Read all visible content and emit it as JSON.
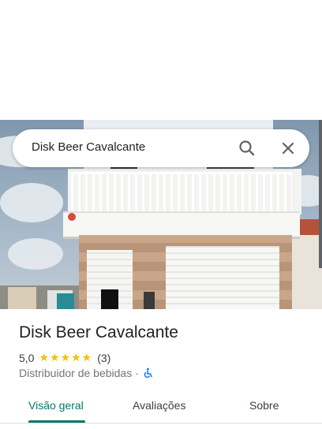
{
  "search": {
    "query": "Disk Beer Cavalcante"
  },
  "place": {
    "name": "Disk Beer Cavalcante",
    "rating": "5,0",
    "stars": "★★★★★",
    "review_count": "(3)",
    "category": "Distribuidor de bebidas",
    "separator": "·"
  },
  "tabs": [
    {
      "label": "Visão geral",
      "active": true
    },
    {
      "label": "Avaliações",
      "active": false
    },
    {
      "label": "Sobre",
      "active": false
    }
  ],
  "icons": {
    "search": "search-icon",
    "close": "close-icon",
    "accessibility": "wheelchair-icon"
  },
  "colors": {
    "accent": "#00796b",
    "star": "#fbbc04",
    "text": "#202124",
    "muted": "#70757a"
  }
}
